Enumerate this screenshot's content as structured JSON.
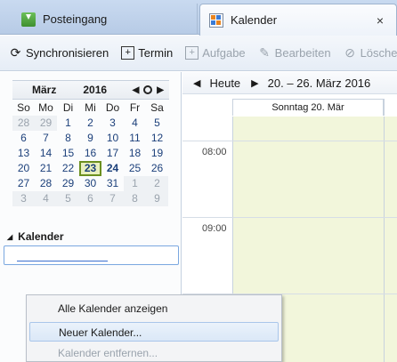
{
  "tabs": [
    {
      "label": "Posteingang",
      "icon": "inbox-icon"
    },
    {
      "label": "Kalender",
      "icon": "calendar-icon",
      "close": "×"
    }
  ],
  "toolbar": {
    "sync": "Synchronisieren",
    "termin": "Termin",
    "aufgabe": "Aufgabe",
    "bearbeiten": "Bearbeiten",
    "loeschen": "Löschen"
  },
  "minical": {
    "month": "März",
    "year": "2016",
    "weekdays": [
      "So",
      "Mo",
      "Di",
      "Mi",
      "Do",
      "Fr",
      "Sa"
    ],
    "weeks": [
      [
        [
          "28",
          "other"
        ],
        [
          "29",
          "other"
        ],
        [
          "1",
          ""
        ],
        [
          "2",
          ""
        ],
        [
          "3",
          ""
        ],
        [
          "4",
          ""
        ],
        [
          "5",
          ""
        ]
      ],
      [
        [
          "6",
          ""
        ],
        [
          "7",
          ""
        ],
        [
          "8",
          ""
        ],
        [
          "9",
          ""
        ],
        [
          "10",
          ""
        ],
        [
          "11",
          ""
        ],
        [
          "12",
          ""
        ]
      ],
      [
        [
          "13",
          ""
        ],
        [
          "14",
          ""
        ],
        [
          "15",
          ""
        ],
        [
          "16",
          ""
        ],
        [
          "17",
          ""
        ],
        [
          "18",
          ""
        ],
        [
          "19",
          ""
        ]
      ],
      [
        [
          "20",
          ""
        ],
        [
          "21",
          ""
        ],
        [
          "22",
          ""
        ],
        [
          "23",
          "today"
        ],
        [
          "24",
          "bold"
        ],
        [
          "25",
          ""
        ],
        [
          "26",
          ""
        ]
      ],
      [
        [
          "27",
          ""
        ],
        [
          "28",
          ""
        ],
        [
          "29",
          ""
        ],
        [
          "30",
          ""
        ],
        [
          "31",
          ""
        ],
        [
          "1",
          "other"
        ],
        [
          "2",
          "other"
        ]
      ],
      [
        [
          "3",
          "other"
        ],
        [
          "4",
          "other"
        ],
        [
          "5",
          "other"
        ],
        [
          "6",
          "other"
        ],
        [
          "7",
          "other"
        ],
        [
          "8",
          "other"
        ],
        [
          "9",
          "other"
        ]
      ]
    ]
  },
  "calendar_list": {
    "heading": "Kalender",
    "input_value": ""
  },
  "view": {
    "today_label": "Heute",
    "range": "20. – 26. März 2016",
    "day_header": "Sonntag 20. Mär",
    "times": [
      "08:00",
      "09:00"
    ]
  },
  "context_menu": {
    "items": [
      {
        "label": "Alle Kalender anzeigen",
        "state": "normal"
      },
      {
        "label": "Neuer Kalender...",
        "state": "highlighted"
      },
      {
        "label": "Kalender entfernen...",
        "state": "disabled"
      }
    ]
  },
  "colors": {
    "accent": "#3c6fd0",
    "today_bg": "#e8efbf",
    "day_bg": "#f2f6db"
  }
}
